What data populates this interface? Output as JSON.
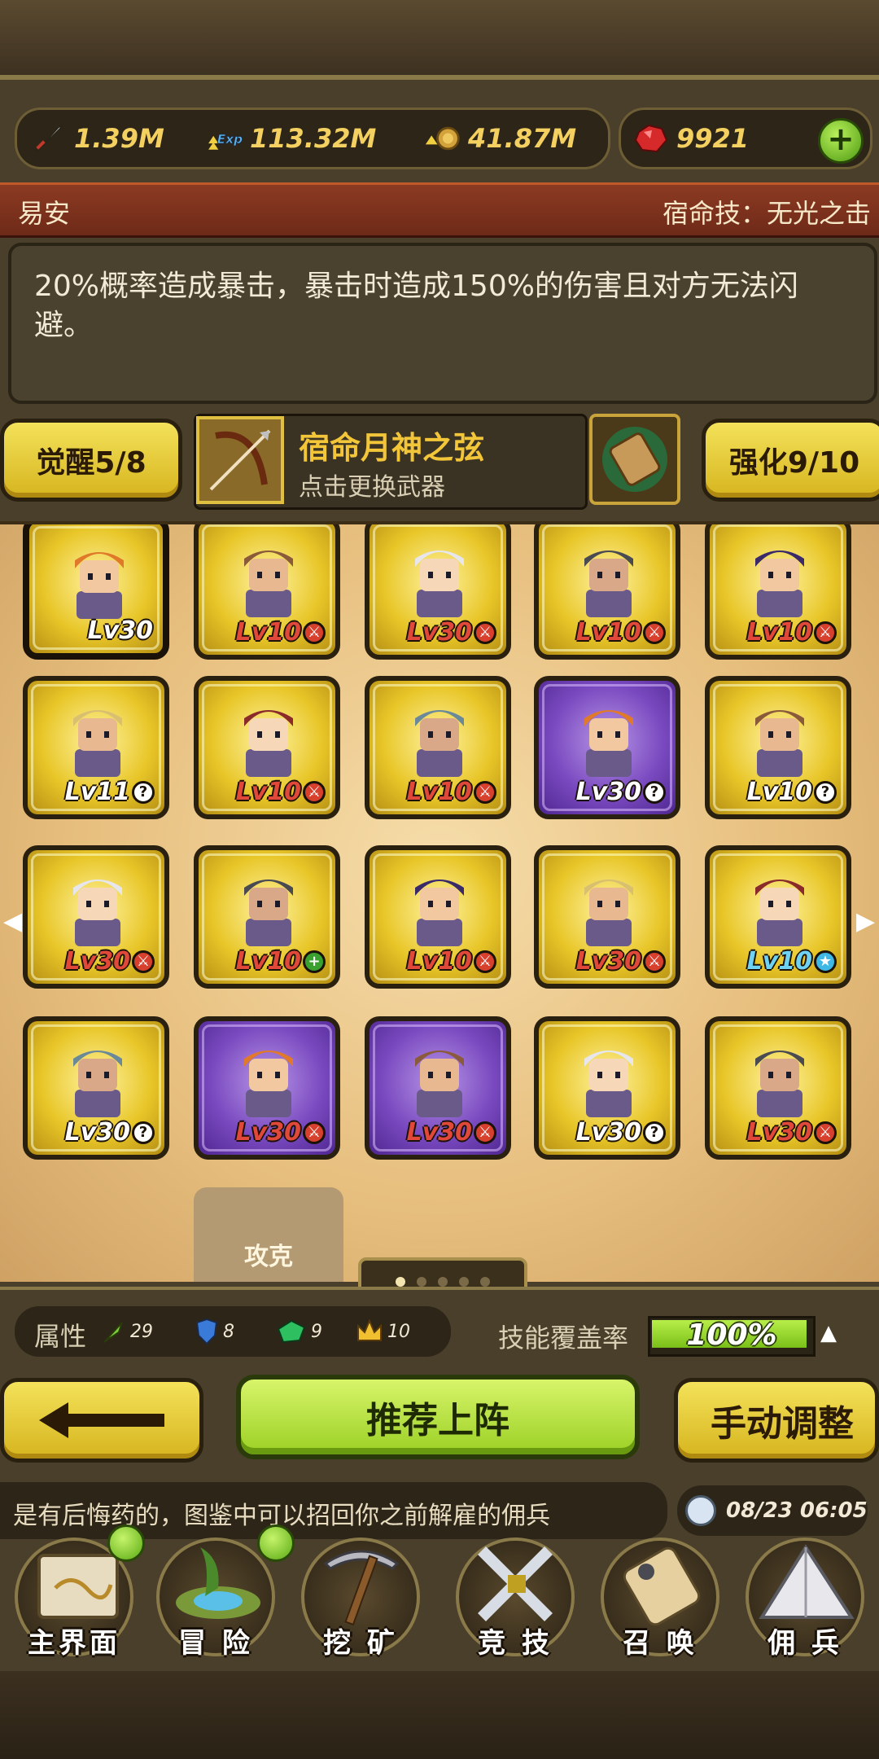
{
  "currency": {
    "attack": "1.39M",
    "exp": "113.32M",
    "gold": "41.87M",
    "gems": "9921"
  },
  "hero": {
    "name": "易安",
    "skill_title": "宿命技：无光之击",
    "description": "20%概率造成暴击，暴击时造成150%的伤害且对方无法闪避。"
  },
  "weapon_row": {
    "awaken": "觉醒5/8",
    "weapon_name": "宿命月神之弦",
    "weapon_hint": "点击更换武器",
    "enhance": "强化9/10"
  },
  "roster": [
    {
      "level": "Lv30",
      "badge": "",
      "frame": "gold",
      "level_color": "white",
      "selected": true
    },
    {
      "level": "Lv10",
      "badge": "sword",
      "frame": "gold",
      "level_color": "red"
    },
    {
      "level": "Lv30",
      "badge": "sword",
      "frame": "gold",
      "level_color": "red"
    },
    {
      "level": "Lv10",
      "badge": "sword",
      "frame": "gold",
      "level_color": "red"
    },
    {
      "level": "Lv10",
      "badge": "sword",
      "frame": "gold",
      "level_color": "red"
    },
    {
      "level": "Lv11",
      "badge": "question",
      "frame": "gold",
      "level_color": "white"
    },
    {
      "level": "Lv10",
      "badge": "sword",
      "frame": "gold",
      "level_color": "red"
    },
    {
      "level": "Lv10",
      "badge": "sword",
      "frame": "gold",
      "level_color": "red"
    },
    {
      "level": "Lv30",
      "badge": "question",
      "frame": "purple",
      "level_color": "white"
    },
    {
      "level": "Lv10",
      "badge": "question",
      "frame": "gold",
      "level_color": "white"
    },
    {
      "level": "Lv30",
      "badge": "sword",
      "frame": "gold",
      "level_color": "red"
    },
    {
      "level": "Lv10",
      "badge": "plus",
      "frame": "gold",
      "level_color": "red"
    },
    {
      "level": "Lv10",
      "badge": "sword",
      "frame": "gold",
      "level_color": "red"
    },
    {
      "level": "Lv30",
      "badge": "sword",
      "frame": "gold",
      "level_color": "red"
    },
    {
      "level": "Lv10",
      "badge": "star",
      "frame": "gold",
      "level_color": "cyan"
    },
    {
      "level": "Lv30",
      "badge": "question",
      "frame": "gold",
      "level_color": "white"
    },
    {
      "level": "Lv30",
      "badge": "sword",
      "frame": "purple",
      "level_color": "red"
    },
    {
      "level": "Lv30",
      "badge": "sword",
      "frame": "purple",
      "level_color": "red"
    },
    {
      "level": "Lv30",
      "badge": "question",
      "frame": "gold",
      "level_color": "white"
    },
    {
      "level": "Lv30",
      "badge": "sword",
      "frame": "gold",
      "level_color": "red"
    }
  ],
  "unlock_card": {
    "text": "攻克"
  },
  "pager": {
    "pages": 5,
    "current": 1
  },
  "attributes": {
    "label": "属性",
    "agility": "29",
    "defense": "8",
    "magic": "9",
    "royal": "10"
  },
  "coverage": {
    "label": "技能覆盖率",
    "value": "100%",
    "fraction": 1.0
  },
  "actions": {
    "recommend": "推荐上阵",
    "manual": "手动调整"
  },
  "ticker": {
    "text": "是有后悔药的，图鉴中可以招回你之前解雇的佣兵",
    "time": "08/23 06:05"
  },
  "nav": [
    {
      "label": "主界面",
      "icon": "map-scroll-icon",
      "notify": true
    },
    {
      "label": "冒 险",
      "icon": "island-icon",
      "notify": true
    },
    {
      "label": "挖 矿",
      "icon": "pickaxe-icon",
      "notify": false
    },
    {
      "label": "竞 技",
      "icon": "crossed-swords-icon",
      "notify": false
    },
    {
      "label": "召 唤",
      "icon": "summon-scroll-icon",
      "notify": false
    },
    {
      "label": "佣 兵",
      "icon": "tent-icon",
      "notify": false
    }
  ],
  "colors": {
    "gold_frame": "#e8c628",
    "purple_frame": "#7a4ac0",
    "accent_green": "#9ad024",
    "title_red": "#8c3a22"
  }
}
